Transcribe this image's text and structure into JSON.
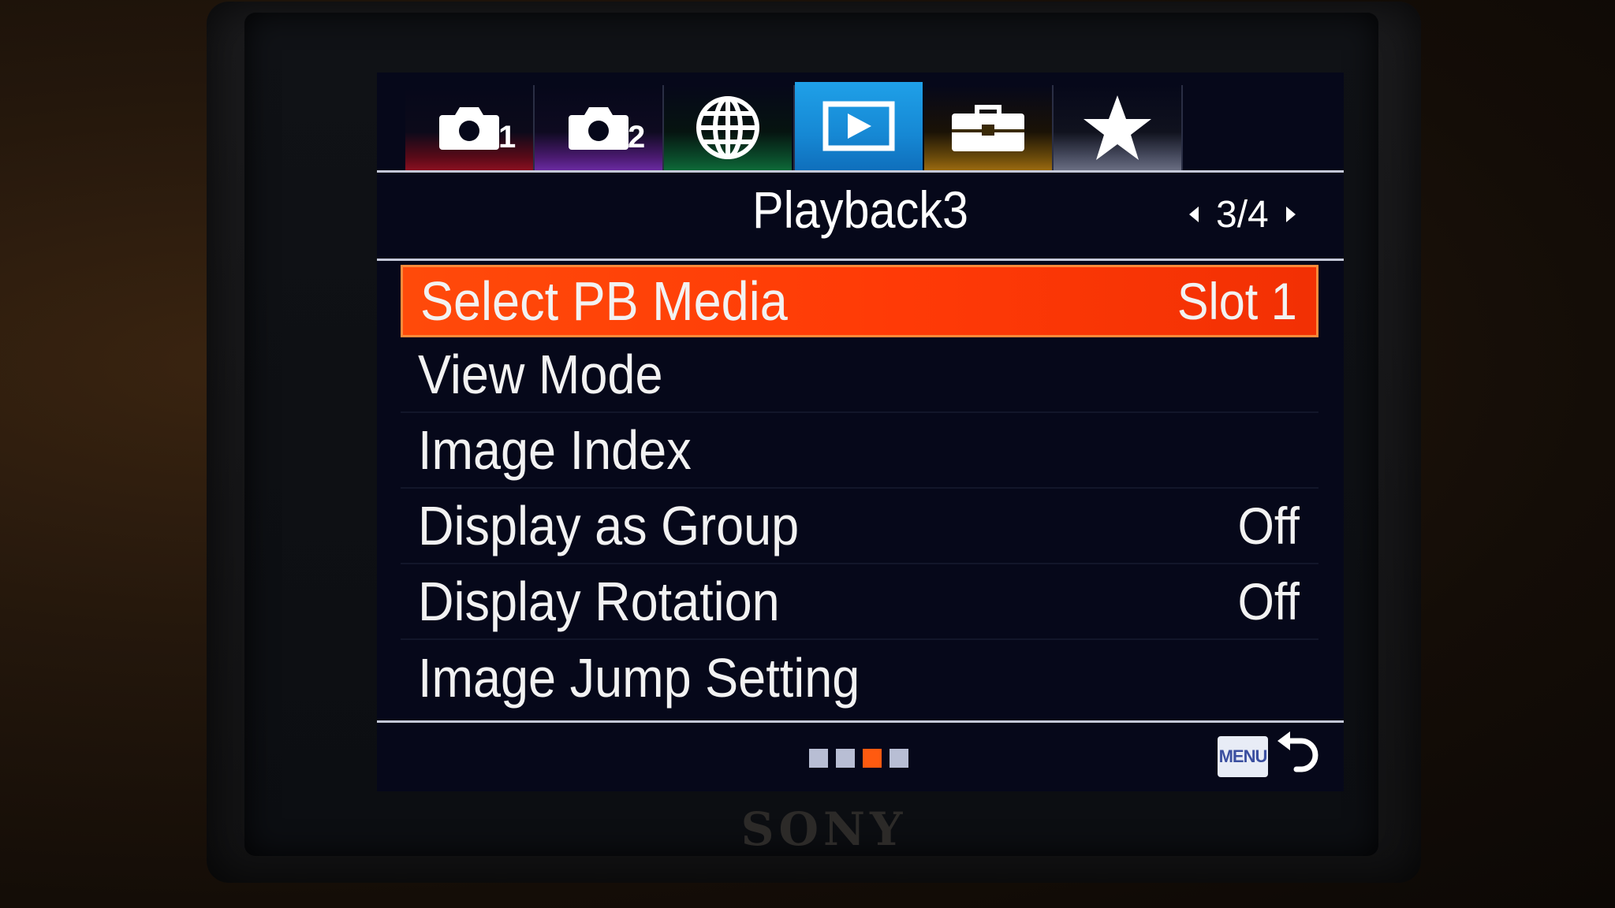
{
  "tabs": [
    {
      "name": "shooting-1",
      "icon": "camera-icon",
      "num": "1",
      "color": "#8a1020"
    },
    {
      "name": "shooting-2",
      "icon": "camera-icon",
      "num": "2",
      "color": "#6a2aa0"
    },
    {
      "name": "network",
      "icon": "globe-icon",
      "num": "",
      "color": "#0e6a38"
    },
    {
      "name": "playback",
      "icon": "play-icon",
      "num": "",
      "color": "#1fa0e8",
      "active": true
    },
    {
      "name": "setup",
      "icon": "toolbox-icon",
      "num": "",
      "color": "#9a6a10"
    },
    {
      "name": "my-menu",
      "icon": "star-icon",
      "num": "",
      "color": "#6a6e82"
    }
  ],
  "header": {
    "title": "Playback3",
    "page": "3/4"
  },
  "menu": {
    "items": [
      {
        "label": "Select PB Media",
        "value": "Slot 1",
        "selected": true
      },
      {
        "label": "View Mode",
        "value": ""
      },
      {
        "label": "Image Index",
        "value": ""
      },
      {
        "label": "Display as Group",
        "value": "Off"
      },
      {
        "label": "Display Rotation",
        "value": "Off"
      },
      {
        "label": "Image Jump Setting",
        "value": ""
      }
    ]
  },
  "footer": {
    "page_indicator": {
      "count": 4,
      "active": 3
    },
    "menu_button": "MENU",
    "back_icon": "back-arrow-icon"
  },
  "brand": "SONY",
  "colors": {
    "highlight": "#ff4a0a",
    "active_tab": "#1fa0e8",
    "screen_bg": "#06081a"
  }
}
